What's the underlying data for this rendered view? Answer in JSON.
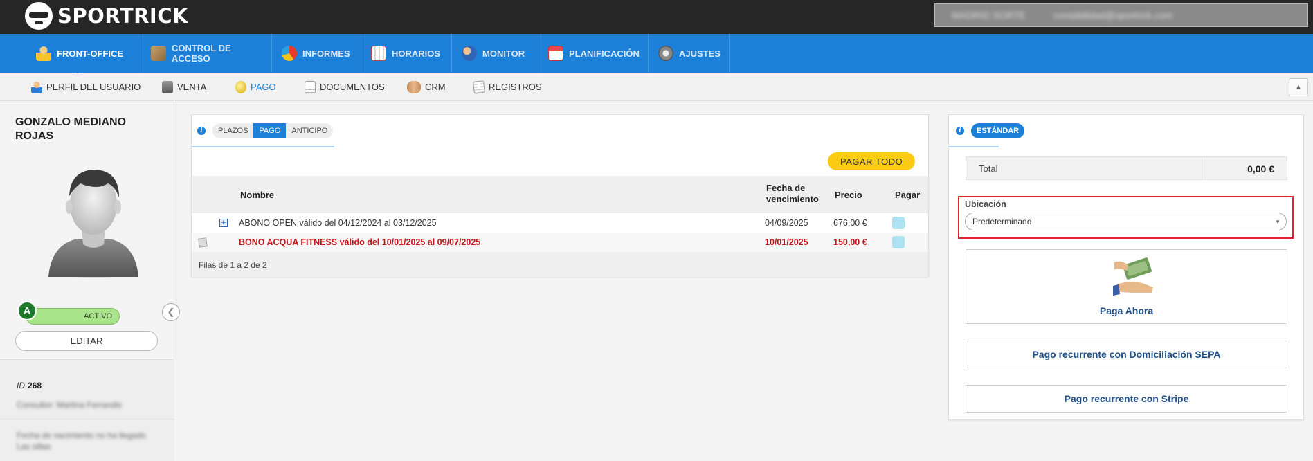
{
  "app": {
    "logo_text": "SPORTRICK",
    "user_name": "MADRID SORTE",
    "user_email": "contabilidad@sportrick.com"
  },
  "main_nav": [
    {
      "label": "FRONT-OFFICE",
      "icon": "person-icon",
      "active": true
    },
    {
      "label": "CONTROL DE ACCESO",
      "icon": "access-icon"
    },
    {
      "label": "INFORMES",
      "icon": "pie-chart-icon"
    },
    {
      "label": "HORARIOS",
      "icon": "schedule-icon"
    },
    {
      "label": "MONITOR",
      "icon": "monitor-person-icon"
    },
    {
      "label": "PLANIFICACIÓN",
      "icon": "calendar-icon"
    },
    {
      "label": "AJUSTES",
      "icon": "gear-icon"
    }
  ],
  "sub_nav": [
    {
      "label": "PERFIL DEL USUARIO",
      "icon": "user-profile-icon"
    },
    {
      "label": "VENTA",
      "icon": "cash-register-icon"
    },
    {
      "label": "PAGO",
      "icon": "coin-icon",
      "active": true
    },
    {
      "label": "DOCUMENTOS",
      "icon": "document-icon"
    },
    {
      "label": "CRM",
      "icon": "handshake-icon"
    },
    {
      "label": "REGISTROS",
      "icon": "register-icon"
    }
  ],
  "customer": {
    "name": "GONZALO MEDIANO ROJAS",
    "status_letter": "A",
    "status": "ACTIVO",
    "edit_label": "EDITAR",
    "id_label": "ID",
    "id_value": "268",
    "consultant": "Consultor: Martina Ferrandis",
    "birth": "Fecha de nacimiento no ha llegado",
    "birth_extra": "Las sillas"
  },
  "payments": {
    "tabs": [
      "PLAZOS",
      "PAGO",
      "ANTICIPO"
    ],
    "active_tab": "PAGO",
    "pay_all_label": "PAGAR TODO",
    "columns": {
      "name": "Nombre",
      "due_1": "Fecha de",
      "due_2": "vencimiento",
      "price": "Precio",
      "pay": "Pagar"
    },
    "rows": [
      {
        "expand": "+",
        "name": "ABONO OPEN válido del 04/12/2024 al 03/12/2025",
        "due": "04/09/2025",
        "price": "676,00 €",
        "overdue": false
      },
      {
        "name": "BONO ACQUA FITNESS válido del 10/01/2025 al 09/07/2025",
        "due": "10/01/2025",
        "price": "150,00 €",
        "overdue": true
      }
    ],
    "footer": "Filas de 1 a 2 de 2"
  },
  "checkout": {
    "tab": "ESTÁNDAR",
    "total_label": "Total",
    "total_value": "0,00 €",
    "location_label": "Ubicación",
    "location_value": "Predeterminado",
    "pay_now": "Paga Ahora",
    "sepa": "Pago recurrente con Domiciliación SEPA",
    "stripe": "Pago recurrente con Stripe"
  },
  "colors": {
    "brand_blue": "#1d80d8",
    "dark_bar": "#262626",
    "accent_yellow": "#fccc15",
    "overdue_red": "#c4151c",
    "status_green": "#1d7a2a"
  }
}
